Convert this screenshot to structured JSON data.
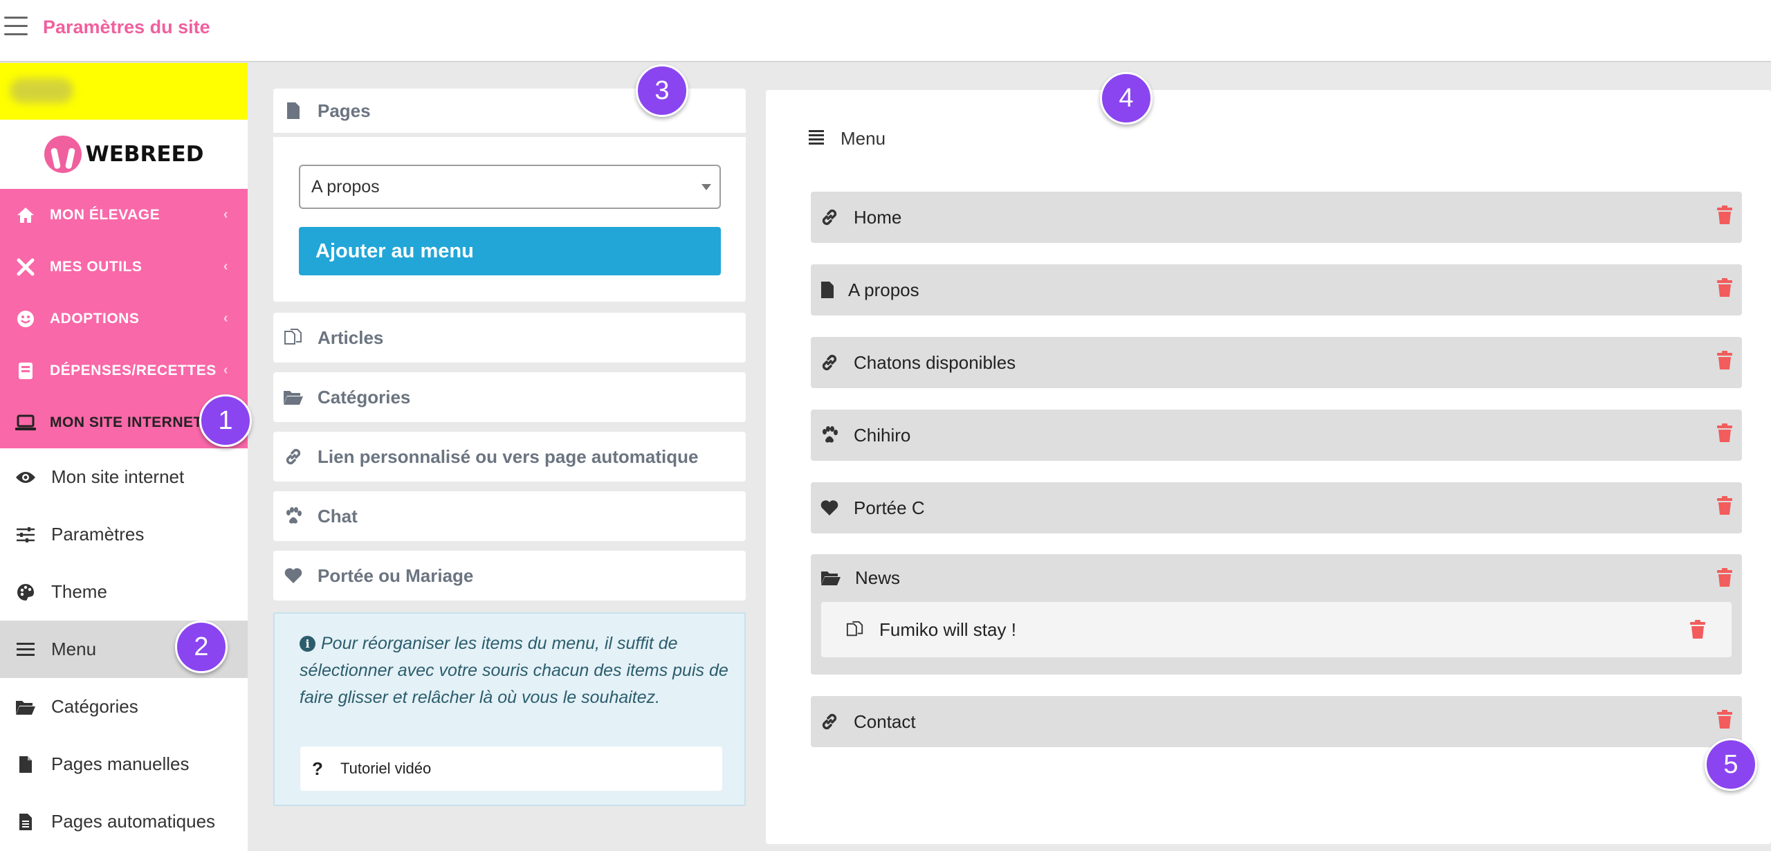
{
  "header": {
    "title": "Paramètres du site"
  },
  "sidebar": {
    "brand": "WEBREED",
    "main_items": [
      {
        "label": "MON ÉLEVAGE",
        "icon": "home-icon"
      },
      {
        "label": "MES OUTILS",
        "icon": "tools-icon"
      },
      {
        "label": "ADOPTIONS",
        "icon": "smile-icon"
      },
      {
        "label": "DÉPENSES/RECETTES",
        "icon": "book-icon"
      },
      {
        "label": "MON SITE INTERNET",
        "icon": "laptop-icon"
      }
    ],
    "sub_items": [
      {
        "label": "Mon site internet",
        "icon": "eye-icon"
      },
      {
        "label": "Paramètres",
        "icon": "sliders-icon"
      },
      {
        "label": "Theme",
        "icon": "palette-icon"
      },
      {
        "label": "Menu",
        "icon": "list-icon"
      },
      {
        "label": "Catégories",
        "icon": "folder-open-icon"
      },
      {
        "label": "Pages manuelles",
        "icon": "file-icon"
      },
      {
        "label": "Pages automatiques",
        "icon": "file-text-icon"
      }
    ]
  },
  "sources": {
    "pages": {
      "title": "Pages",
      "selected": "A propos",
      "add_label": "Ajouter au menu"
    },
    "sections": [
      {
        "label": "Articles",
        "icon": "copy-icon"
      },
      {
        "label": "Catégories",
        "icon": "folder-open-icon"
      },
      {
        "label": "Lien personnalisé ou vers page automatique",
        "icon": "link-icon"
      },
      {
        "label": "Chat",
        "icon": "paw-icon"
      },
      {
        "label": "Portée ou Mariage",
        "icon": "heart-icon"
      }
    ],
    "info": {
      "text": "Pour réorganiser les items du menu, il suffit de sélectionner avec votre souris chacun des items puis de faire glisser et relâcher là où vous le souhaitez.",
      "tutorial": "Tutoriel vidéo"
    }
  },
  "menu": {
    "title": "Menu",
    "items": [
      {
        "label": "Home",
        "icon": "link-icon"
      },
      {
        "label": "A propos",
        "icon": "file-icon"
      },
      {
        "label": "Chatons disponibles",
        "icon": "link-icon"
      },
      {
        "label": "Chihiro",
        "icon": "paw-icon"
      },
      {
        "label": "Portée C",
        "icon": "heart-icon"
      }
    ],
    "group": {
      "label": "News",
      "icon": "folder-open-icon",
      "child": "Fumiko will stay !"
    },
    "last": {
      "label": "Contact",
      "icon": "link-icon"
    }
  },
  "badges": [
    "1",
    "2",
    "3",
    "4",
    "5"
  ],
  "colors": {
    "brand_pink": "#f968a8",
    "title_pink": "#f0609e",
    "button_blue": "#22a6d8",
    "badge_purple": "#8a45f0",
    "trash_red": "#f25c5c",
    "highlight_yellow": "#ffff00"
  }
}
